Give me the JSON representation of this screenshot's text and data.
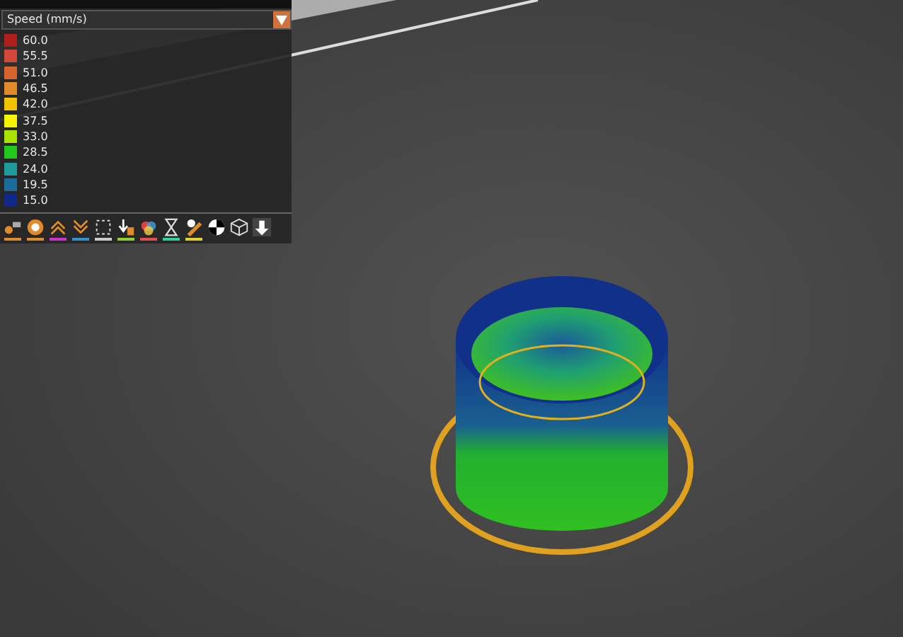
{
  "legend": {
    "view_type": {
      "value": "Speed (mm/s)"
    },
    "items": [
      {
        "label": "60.0",
        "color": "#b0201a"
      },
      {
        "label": "55.5",
        "color": "#d4483a"
      },
      {
        "label": "51.0",
        "color": "#d8632f"
      },
      {
        "label": "46.5",
        "color": "#e08a2a"
      },
      {
        "label": "42.0",
        "color": "#f2c400"
      },
      {
        "label": "37.5",
        "color": "#f5f500"
      },
      {
        "label": "33.0",
        "color": "#a8e400"
      },
      {
        "label": "28.5",
        "color": "#22c81e"
      },
      {
        "label": "24.0",
        "color": "#1e9a9a"
      },
      {
        "label": "19.5",
        "color": "#1a6c9a"
      },
      {
        "label": "15.0",
        "color": "#10288a"
      }
    ]
  },
  "toolbar": {
    "items": [
      {
        "kind": "underlined",
        "color": "#e08a2a"
      },
      {
        "kind": "underlined",
        "color": "#e08a2a"
      },
      {
        "kind": "underlined",
        "color": "#d030d0"
      },
      {
        "kind": "underlined",
        "color": "#3090d0"
      },
      {
        "kind": "underlined",
        "color": "#cccccc"
      },
      {
        "kind": "underlined",
        "color": "#90d030"
      },
      {
        "kind": "underlined",
        "color": "#e05050"
      },
      {
        "kind": "underlined",
        "color": "#30d0a0"
      },
      {
        "kind": "underlined",
        "color": "#e0d030"
      },
      {
        "kind": "plain"
      },
      {
        "kind": "plain"
      },
      {
        "kind": "plain"
      }
    ]
  }
}
